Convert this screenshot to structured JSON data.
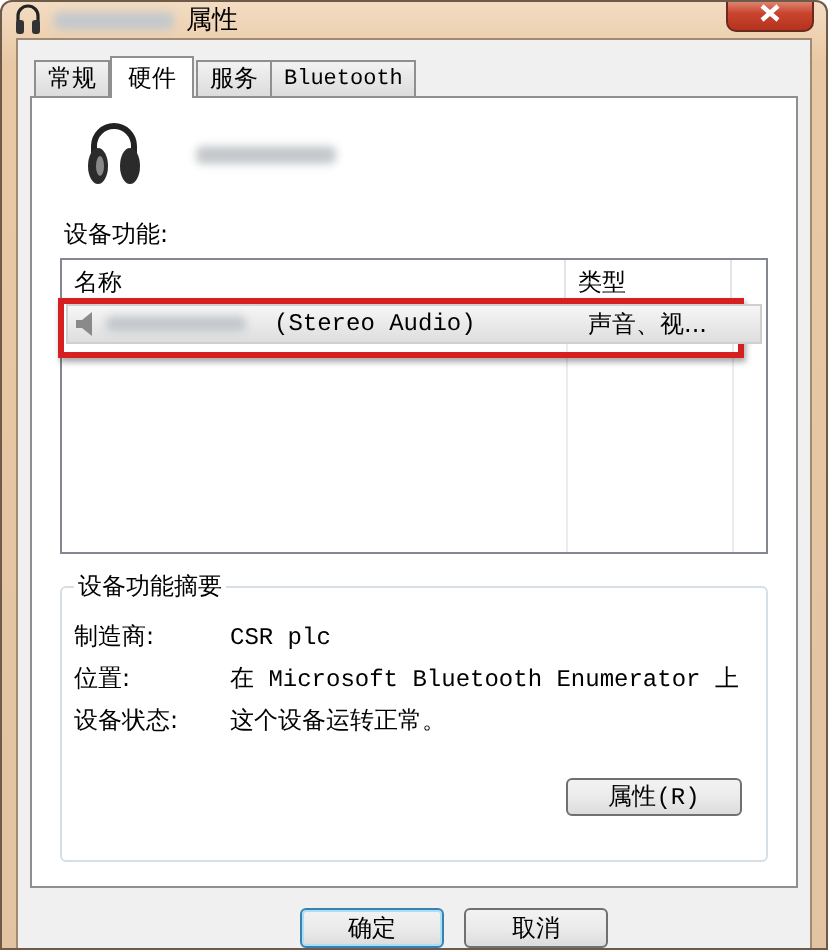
{
  "window": {
    "title": "属性"
  },
  "tabs": [
    {
      "label": "常规",
      "selected": false
    },
    {
      "label": "硬件",
      "selected": true
    },
    {
      "label": "服务",
      "selected": false
    },
    {
      "label": "Bluetooth",
      "selected": false
    }
  ],
  "functions": {
    "label": "设备功能:",
    "columns": [
      "名称",
      "类型"
    ],
    "rows": [
      {
        "name": "(Stereo Audio)",
        "type": "声音、视...",
        "selected": true,
        "highlighted": true
      }
    ]
  },
  "summary": {
    "title": "设备功能摘要",
    "fields": [
      {
        "label": "制造商:",
        "value": "CSR plc"
      },
      {
        "label": "位置:",
        "value": "在 Microsoft Bluetooth Enumerator 上"
      },
      {
        "label": "设备状态:",
        "value": "这个设备运转正常。"
      }
    ],
    "button": "属性(R)"
  },
  "buttons": [
    "确定",
    "取消"
  ]
}
